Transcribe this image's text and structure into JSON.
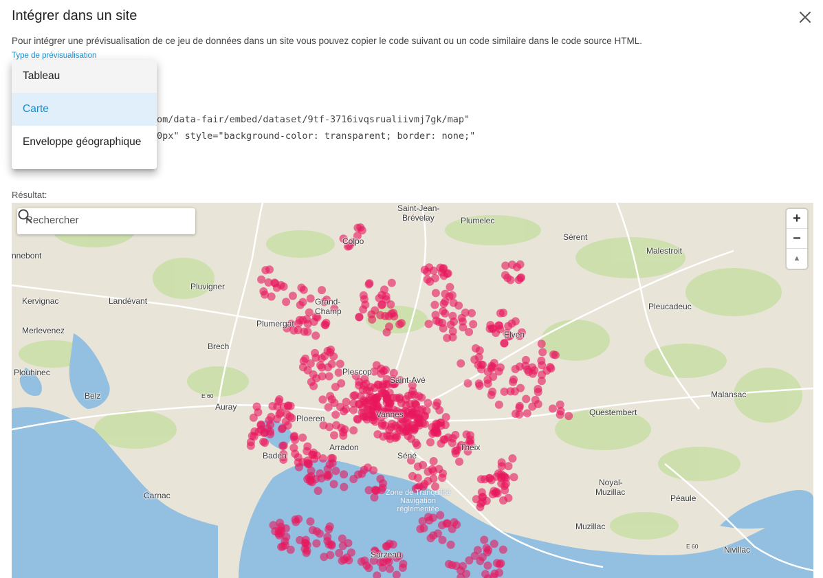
{
  "dialog": {
    "title": "Intégrer dans un site",
    "description": "Pour intégrer une prévisualisation de ce jeu de données dans un site vous pouvez copier le code suivant ou un code similaire dans le code source HTML.",
    "select_label": "Type de prévisualisation",
    "close_icon": "close-icon"
  },
  "menu": {
    "items": [
      {
        "label": "Tableau"
      },
      {
        "label": "Carte"
      },
      {
        "label": "Enveloppe géographique"
      }
    ],
    "selected": "Carte"
  },
  "code": {
    "line1": "om/data-fair/embed/dataset/9tf-3716ivqsrualiivmj7gk/map\"",
    "line2": "0px\" style=\"background-color: transparent; border: none;\""
  },
  "result_label": "Résultat:",
  "map": {
    "search_placeholder": "Rechercher",
    "zoom_in": "+",
    "zoom_out": "−",
    "compass": "▲",
    "colors": {
      "land": "#e8e4d8",
      "water": "#93bfe0",
      "green": "#c9dfa6",
      "marker": "#e8175d"
    },
    "labels": {
      "saint_jean": "Saint-Jean-",
      "brevelay": "Brévelay",
      "plumelec": "Plumelec",
      "serent": "Sérent",
      "malestroit": "Malestroit",
      "colpo": "Colpo",
      "nnebont": "nnebont",
      "pluvigner": "Pluvigner",
      "kervignac": "Kervignac",
      "landevant": "Landévant",
      "grand": "Grand-",
      "champ": "Champ",
      "pleucadeuc": "Pleucadeuc",
      "merlevenez": "Merlevenez",
      "plumergat": "Plumergat",
      "elven": "Elven",
      "brech": "Brech",
      "plouhinec": "Plouhinec",
      "plescop": "Plescop",
      "saint_ave": "Saint-Avé",
      "belz": "Belz",
      "auray": "Auray",
      "vannes": "Vannes",
      "malansac": "Malansac",
      "questembert": "Questembert",
      "ploeren": "Ploeren",
      "baden": "Baden",
      "arradon": "Arradon",
      "sene": "Séné",
      "theix": "Theix",
      "carnac": "Carnac",
      "zone1": "Zone de Tranquilité",
      "zone2": "Navigation",
      "zone3": "réglementée",
      "noyal": "Noyal-",
      "muzillac_top": "Muzillac",
      "peaule": "Péaule",
      "muzillac": "Muzillac",
      "sarzeau": "Sarzeau",
      "nivillac": "Nivillac",
      "e60a": "E 60",
      "e60b": "E 60"
    }
  }
}
